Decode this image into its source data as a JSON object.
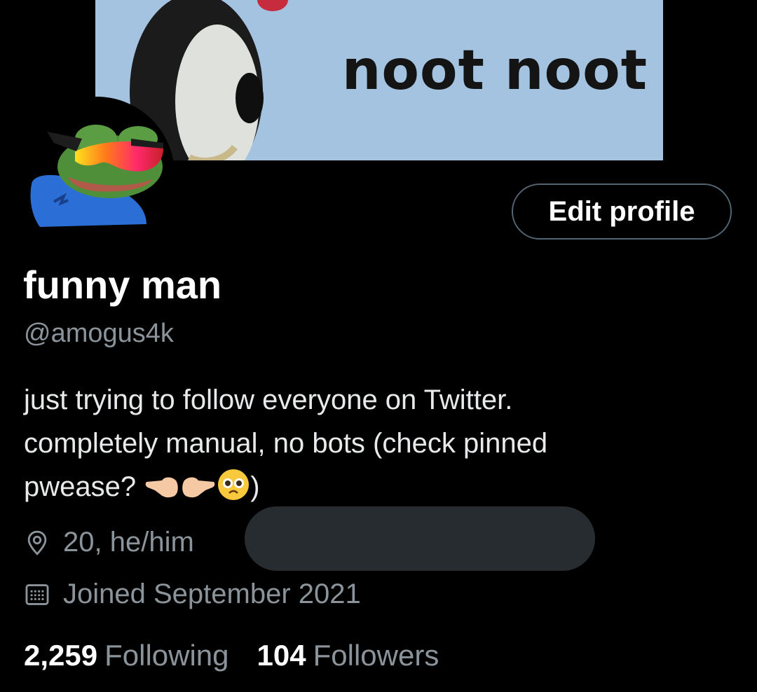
{
  "banner": {
    "text": "noot noot",
    "background": "#a3c3e1"
  },
  "avatar": {
    "icon": "pepe-sunglasses-avatar"
  },
  "profile": {
    "edit_label": "Edit profile",
    "display_name": "funny man",
    "handle": "@amogus4k",
    "bio_line1": "just trying to follow everyone on Twitter.",
    "bio_line2": "completely manual, no bots (check pinned",
    "bio_line3": "pwease?",
    "bio_line3_end": ")",
    "location": "20, he/him",
    "joined": "Joined September 2021"
  },
  "stats": {
    "following_count": "2,259",
    "following_label": "Following",
    "followers_count": "104",
    "followers_label": "Followers"
  },
  "colors": {
    "background": "#000000",
    "secondary_text": "#8b949b",
    "redaction": "#272c31"
  }
}
